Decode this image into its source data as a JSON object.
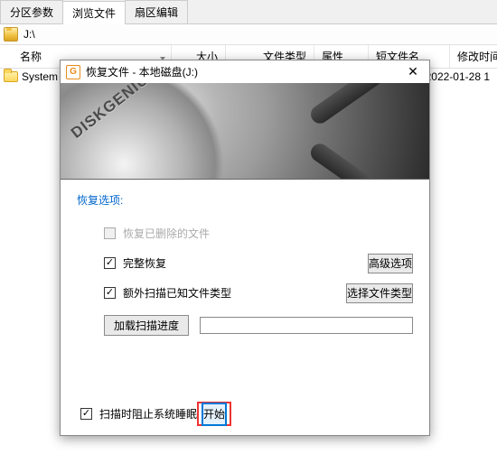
{
  "tabs": {
    "t0": "分区参数",
    "t1": "浏览文件",
    "t2": "扇区编辑"
  },
  "path": "J:\\",
  "columns": {
    "name": "名称",
    "size": "大小",
    "type": "文件类型",
    "attr": "属性",
    "short": "短文件名",
    "modified": "修改时间"
  },
  "rows": [
    {
      "name": "System",
      "date": "2022-01-28 1"
    }
  ],
  "dialog": {
    "title": "恢复文件 - 本地磁盘(J:)",
    "hero_brand": "DISKGENIUS",
    "options_header": "恢复选项:",
    "opt_deleted": "恢复已删除的文件",
    "opt_full": "完整恢复",
    "btn_advanced": "高级选项",
    "opt_known": "额外扫描已知文件类型",
    "btn_select_type": "选择文件类型",
    "btn_load_progress": "加载扫描进度",
    "opt_prevent_sleep": "扫描时阻止系统睡眠",
    "btn_start": "开始"
  }
}
